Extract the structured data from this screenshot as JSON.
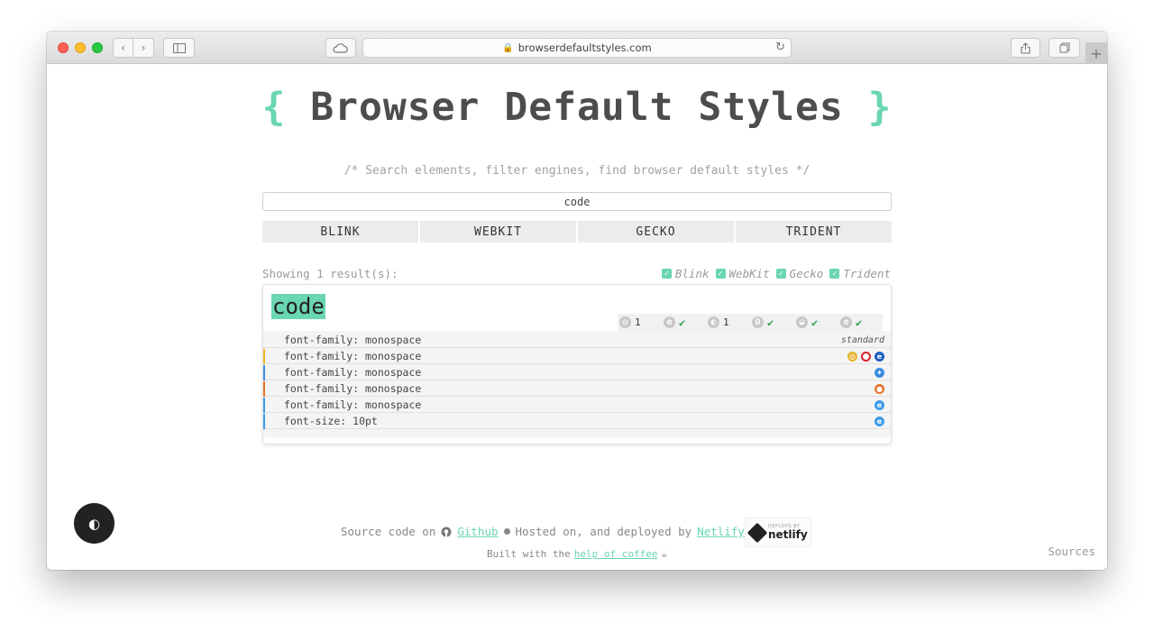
{
  "browser": {
    "url": "browserdefaultstyles.com"
  },
  "site": {
    "brace_open": "{",
    "title": "Browser Default Styles",
    "brace_close": "}",
    "subtitle": "/* Search elements, filter engines, find browser default styles */"
  },
  "search": {
    "value": "code"
  },
  "engines": [
    "BLINK",
    "WEBKIT",
    "GECKO",
    "TRIDENT"
  ],
  "results": {
    "showing": "Showing 1 result(s):",
    "filters": [
      "Blink",
      "WebKit",
      "Gecko",
      "Trident"
    ]
  },
  "element": {
    "name": "code",
    "support": [
      {
        "icon": "chrome-icon",
        "value": "1"
      },
      {
        "icon": "edge-icon",
        "value": "✔"
      },
      {
        "icon": "safari-icon",
        "value": "1"
      },
      {
        "icon": "opera-icon",
        "value": "✔"
      },
      {
        "icon": "firefox-icon",
        "value": "✔"
      },
      {
        "icon": "ie-icon",
        "value": "✔"
      }
    ],
    "properties": [
      {
        "text": "font-family: monospace",
        "tag": "standard",
        "color": ""
      },
      {
        "text": "font-family: monospace",
        "tag": "",
        "color": "#f0b429"
      },
      {
        "text": "font-family: monospace",
        "tag": "",
        "color": "#3d8de0"
      },
      {
        "text": "font-family: monospace",
        "tag": "",
        "color": "#e8742a"
      },
      {
        "text": "font-family: monospace",
        "tag": "",
        "color": "#3d9be9"
      },
      {
        "text": "font-size: 10pt",
        "tag": "",
        "color": "#3d9be9"
      }
    ]
  },
  "footer": {
    "source_text": "Source code on",
    "github": "Github",
    "hosted_text": "Hosted on, and deployed by",
    "netlify": "Netlify",
    "badge_small": "DEPLOYS BY",
    "badge_word": "netlify",
    "built_text": "Built with the",
    "coffee": "help of coffee",
    "sources": "Sources"
  },
  "colors": {
    "accent": "#6ad6b2",
    "check": "#2fa44f"
  }
}
